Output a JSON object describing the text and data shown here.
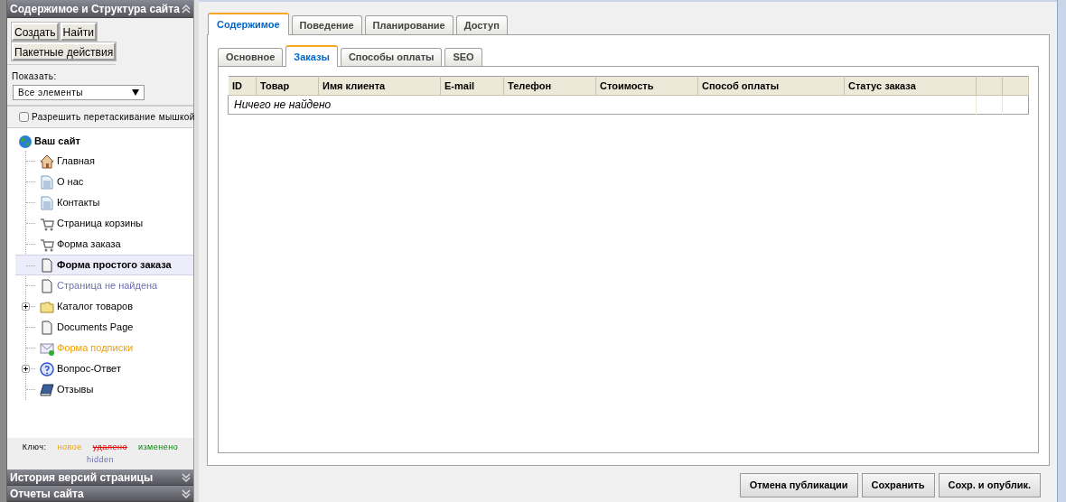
{
  "sidebar": {
    "title": "Содержимое и Структура сайта",
    "expanded": true,
    "buttons": [
      "Создать",
      "Найти",
      "Пакетные действия"
    ],
    "show_filter": {
      "label": "Показать:",
      "value": "Все элементы"
    },
    "drag_option": {
      "label": "Разрешить перетаскивание мышкой",
      "checked": false
    },
    "tree": {
      "label": "Ваш сайт",
      "kind": "globe",
      "children": [
        {
          "label": "Главная",
          "kind": "house",
          "hidden": false,
          "new": false,
          "selected": false
        },
        {
          "label": "О нас",
          "kind": "text-page",
          "hidden": false,
          "new": false,
          "selected": false
        },
        {
          "label": "Контакты",
          "kind": "text-page",
          "hidden": false,
          "new": false,
          "selected": false
        },
        {
          "label": "Страница корзины",
          "kind": "cart",
          "hidden": false,
          "new": false,
          "selected": false
        },
        {
          "label": "Форма заказа",
          "kind": "cart",
          "hidden": false,
          "new": false,
          "selected": false
        },
        {
          "label": "Форма простого заказа",
          "kind": "page",
          "hidden": false,
          "new": false,
          "selected": true
        },
        {
          "label": "Страница не найдена",
          "kind": "page",
          "hidden": true,
          "new": false,
          "selected": false
        },
        {
          "label": "Каталог товаров",
          "kind": "folder",
          "hidden": false,
          "new": false,
          "selected": false,
          "expanded": false
        },
        {
          "label": "Documents Page",
          "kind": "page",
          "hidden": false,
          "new": false,
          "selected": false
        },
        {
          "label": "Форма подписки",
          "kind": "mail",
          "hidden": false,
          "new": true,
          "selected": false
        },
        {
          "label": "Вопрос-Ответ",
          "kind": "question",
          "hidden": false,
          "new": false,
          "selected": false,
          "expanded": false
        },
        {
          "label": "Отзывы",
          "kind": "book",
          "hidden": false,
          "new": false,
          "selected": false
        }
      ]
    },
    "legend": {
      "label": "Ключ:",
      "items": [
        {
          "label": "новое",
          "kind": "new"
        },
        {
          "label": "удалено",
          "kind": "deleted"
        },
        {
          "label": "изменено",
          "kind": "changed"
        },
        {
          "label": "hidden",
          "kind": "hidden"
        }
      ]
    },
    "panels": [
      {
        "title": "История версий страницы",
        "expanded": false
      },
      {
        "title": "Отчеты сайта",
        "expanded": false
      }
    ]
  },
  "tabs": [
    {
      "label": "Содержимое",
      "selected": true
    },
    {
      "label": "Поведение",
      "selected": false
    },
    {
      "label": "Планирование",
      "selected": false
    },
    {
      "label": "Доступ",
      "selected": false
    }
  ],
  "subtabs": [
    {
      "label": "Основное",
      "selected": false
    },
    {
      "label": "Заказы",
      "selected": true
    },
    {
      "label": "Способы оплаты",
      "selected": false
    },
    {
      "label": "SEO",
      "selected": false
    }
  ],
  "table": {
    "columns": [
      {
        "label": "ID"
      },
      {
        "label": "Товар"
      },
      {
        "label": "Имя клиента"
      },
      {
        "label": "E-mail"
      },
      {
        "label": "Телефон"
      },
      {
        "label": "Стоимость"
      },
      {
        "label": "Способ оплаты"
      },
      {
        "label": "Статус заказа"
      },
      {
        "kind": "blank"
      },
      {
        "kind": "blank"
      }
    ],
    "empty_message": "Ничего не найдено"
  },
  "actions": [
    "Отмена публикации",
    "Сохранить",
    "Сохр. и опублик."
  ]
}
